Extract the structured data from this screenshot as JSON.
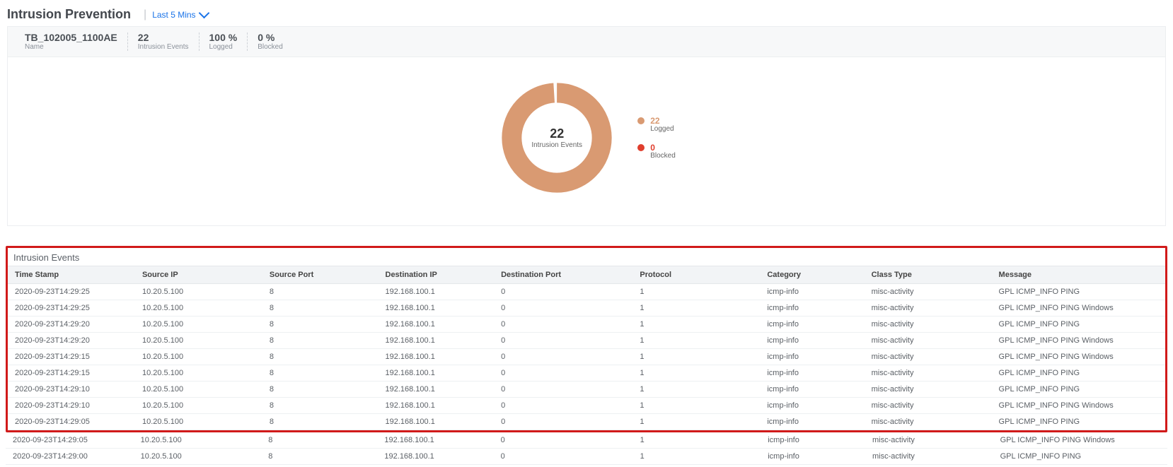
{
  "header": {
    "title": "Intrusion Prevention",
    "time_range": "Last 5 Mins"
  },
  "summary": {
    "device_name": "TB_102005_1100AE",
    "device_label": "Name",
    "events_value": "22",
    "events_label": "Intrusion Events",
    "logged_value": "100 %",
    "logged_label": "Logged",
    "blocked_value": "0 %",
    "blocked_label": "Blocked"
  },
  "chart_data": {
    "type": "pie",
    "title": "",
    "center_value": "22",
    "center_label": "Intrusion Events",
    "series": [
      {
        "name": "Logged",
        "value": 22,
        "color": "#d99a72"
      },
      {
        "name": "Blocked",
        "value": 0,
        "color": "#e03e2d"
      }
    ]
  },
  "legend": {
    "logged_value": "22",
    "logged_label": "Logged",
    "blocked_value": "0",
    "blocked_label": "Blocked"
  },
  "table": {
    "title": "Intrusion Events",
    "columns": [
      "Time Stamp",
      "Source IP",
      "Source Port",
      "Destination IP",
      "Destination Port",
      "Protocol",
      "Category",
      "Class Type",
      "Message"
    ],
    "rows_in_frame": [
      [
        "2020-09-23T14:29:25",
        "10.20.5.100",
        "8",
        "192.168.100.1",
        "0",
        "1",
        "icmp-info",
        "misc-activity",
        "GPL ICMP_INFO PING"
      ],
      [
        "2020-09-23T14:29:25",
        "10.20.5.100",
        "8",
        "192.168.100.1",
        "0",
        "1",
        "icmp-info",
        "misc-activity",
        "GPL ICMP_INFO PING Windows"
      ],
      [
        "2020-09-23T14:29:20",
        "10.20.5.100",
        "8",
        "192.168.100.1",
        "0",
        "1",
        "icmp-info",
        "misc-activity",
        "GPL ICMP_INFO PING"
      ],
      [
        "2020-09-23T14:29:20",
        "10.20.5.100",
        "8",
        "192.168.100.1",
        "0",
        "1",
        "icmp-info",
        "misc-activity",
        "GPL ICMP_INFO PING Windows"
      ],
      [
        "2020-09-23T14:29:15",
        "10.20.5.100",
        "8",
        "192.168.100.1",
        "0",
        "1",
        "icmp-info",
        "misc-activity",
        "GPL ICMP_INFO PING Windows"
      ],
      [
        "2020-09-23T14:29:15",
        "10.20.5.100",
        "8",
        "192.168.100.1",
        "0",
        "1",
        "icmp-info",
        "misc-activity",
        "GPL ICMP_INFO PING"
      ],
      [
        "2020-09-23T14:29:10",
        "10.20.5.100",
        "8",
        "192.168.100.1",
        "0",
        "1",
        "icmp-info",
        "misc-activity",
        "GPL ICMP_INFO PING"
      ],
      [
        "2020-09-23T14:29:10",
        "10.20.5.100",
        "8",
        "192.168.100.1",
        "0",
        "1",
        "icmp-info",
        "misc-activity",
        "GPL ICMP_INFO PING Windows"
      ],
      [
        "2020-09-23T14:29:05",
        "10.20.5.100",
        "8",
        "192.168.100.1",
        "0",
        "1",
        "icmp-info",
        "misc-activity",
        "GPL ICMP_INFO PING"
      ]
    ],
    "rows_below_frame": [
      [
        "2020-09-23T14:29:05",
        "10.20.5.100",
        "8",
        "192.168.100.1",
        "0",
        "1",
        "icmp-info",
        "misc-activity",
        "GPL ICMP_INFO PING Windows"
      ],
      [
        "2020-09-23T14:29:00",
        "10.20.5.100",
        "8",
        "192.168.100.1",
        "0",
        "1",
        "icmp-info",
        "misc-activity",
        "GPL ICMP_INFO PING"
      ]
    ]
  }
}
